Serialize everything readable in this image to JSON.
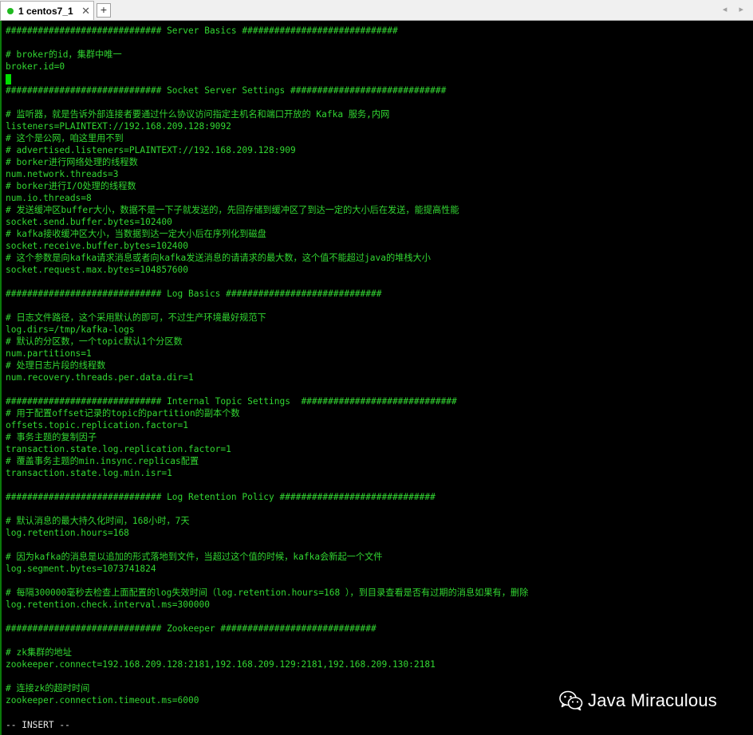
{
  "tab": {
    "label": "1 centos7_1",
    "close": "✕"
  },
  "new_tab": "+",
  "nav": "◂ ▸",
  "editor": {
    "lines": [
      "############################# Server Basics #############################",
      "",
      "# broker的id，集群中唯一",
      "broker.id=0",
      "",
      "############################# Socket Server Settings #############################",
      "",
      "# 监听器，就是告诉外部连接者要通过什么协议访问指定主机名和端口开放的 Kafka 服务,内网",
      "listeners=PLAINTEXT://192.168.209.128:9092",
      "# 这个是公网，咱这里用不到",
      "# advertised.listeners=PLAINTEXT://192.168.209.128:909",
      "# borker进行网络处理的线程数",
      "num.network.threads=3",
      "# borker进行I/O处理的线程数",
      "num.io.threads=8",
      "# 发送缓冲区buffer大小，数据不是一下子就发送的，先回存储到缓冲区了到达一定的大小后在发送，能提高性能",
      "socket.send.buffer.bytes=102400",
      "# kafka接收缓冲区大小，当数据到达一定大小后在序列化到磁盘",
      "socket.receive.buffer.bytes=102400",
      "# 这个参数是向kafka请求消息或者向kafka发送消息的请请求的最大数，这个值不能超过java的堆栈大小",
      "socket.request.max.bytes=104857600",
      "",
      "############################# Log Basics #############################",
      "",
      "# 日志文件路径，这个采用默认的即可，不过生产环境最好规范下",
      "log.dirs=/tmp/kafka-logs",
      "# 默认的分区数，一个topic默认1个分区数",
      "num.partitions=1",
      "# 处理日志片段的线程数",
      "num.recovery.threads.per.data.dir=1",
      "",
      "############################# Internal Topic Settings  #############################",
      "# 用于配置offset记录的topic的partition的副本个数",
      "offsets.topic.replication.factor=1",
      "# 事务主题的复制因子",
      "transaction.state.log.replication.factor=1",
      "# 覆盖事务主题的min.insync.replicas配置",
      "transaction.state.log.min.isr=1",
      "",
      "############################# Log Retention Policy #############################",
      "",
      "# 默认消息的最大持久化时间，168小时，7天",
      "log.retention.hours=168",
      "",
      "# 因为kafka的消息是以追加的形式落地到文件，当超过这个值的时候，kafka会新起一个文件",
      "log.segment.bytes=1073741824",
      "",
      "# 每隔300000毫秒去检查上面配置的log失效时间（log.retention.hours=168 ），到目录查看是否有过期的消息如果有，删除",
      "log.retention.check.interval.ms=300000",
      "",
      "############################# Zookeeper #############################",
      "",
      "# zk集群的地址",
      "zookeeper.connect=192.168.209.128:2181,192.168.209.129:2181,192.168.209.130:2181",
      "",
      "# 连接zk的超时时间",
      "zookeeper.connection.timeout.ms=6000"
    ],
    "cursor_line": 4,
    "mode": "-- INSERT --"
  },
  "watermark": {
    "text": "Java Miraculous",
    "icon": "wechat-icon"
  },
  "colors": {
    "background": "#000000",
    "text": "#32d732",
    "cursor": "#00e000",
    "tab_dot": "#1fb91f"
  }
}
